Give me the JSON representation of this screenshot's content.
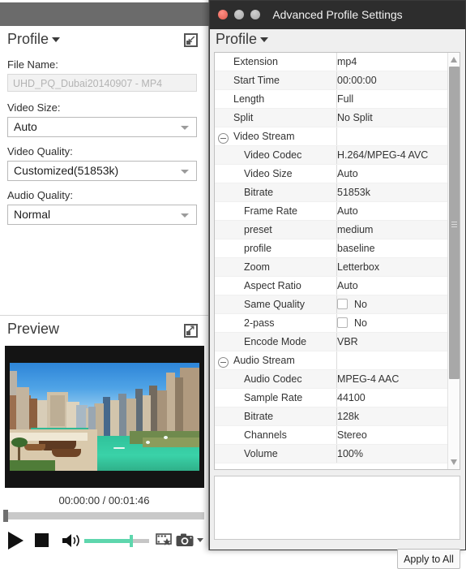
{
  "left_window": {
    "profile_section": {
      "title": "Profile",
      "collapse_icon": "collapse-arrow-icon",
      "file_name_label": "File Name:",
      "file_name_value": "UHD_PQ_Dubai20140907 - MP4",
      "video_size_label": "Video Size:",
      "video_size_value": "Auto",
      "video_quality_label": "Video Quality:",
      "video_quality_value": "Customized(51853k)",
      "audio_quality_label": "Audio Quality:",
      "audio_quality_value": "Normal"
    },
    "preview_section": {
      "title": "Preview",
      "expand_icon": "expand-arrow-icon",
      "time_display": "00:00:00 / 00:01:46",
      "current_time": "00:00:00",
      "total_time": "00:01:46",
      "seek_position_percent": 0,
      "controls": {
        "play": "play-icon",
        "stop": "stop-icon",
        "volume": "volume-icon",
        "volume_percent": 68,
        "snapshot_series": "filmstrip-star-icon",
        "snapshot": "camera-icon",
        "snapshot_menu": "chevron-down-icon"
      }
    }
  },
  "right_window": {
    "title": "Advanced Profile Settings",
    "traffic_lights": [
      "close-button",
      "minimize-button",
      "maximize-button"
    ],
    "profile_title": "Profile",
    "rows": [
      {
        "key": "Extension",
        "value": "mp4",
        "indent": 0,
        "type": "text",
        "group": false
      },
      {
        "key": "Start Time",
        "value": "00:00:00",
        "indent": 0,
        "type": "text",
        "group": false
      },
      {
        "key": "Length",
        "value": "Full",
        "indent": 0,
        "type": "text",
        "group": false
      },
      {
        "key": "Split",
        "value": "No Split",
        "indent": 0,
        "type": "text",
        "group": false
      },
      {
        "key": "Video Stream",
        "value": "",
        "indent": 0,
        "type": "text",
        "group": true
      },
      {
        "key": "Video Codec",
        "value": "H.264/MPEG-4 AVC",
        "indent": 1,
        "type": "text",
        "group": false
      },
      {
        "key": "Video Size",
        "value": "Auto",
        "indent": 1,
        "type": "text",
        "group": false
      },
      {
        "key": "Bitrate",
        "value": "51853k",
        "indent": 1,
        "type": "text",
        "group": false
      },
      {
        "key": "Frame Rate",
        "value": "Auto",
        "indent": 1,
        "type": "text",
        "group": false
      },
      {
        "key": "preset",
        "value": "medium",
        "indent": 1,
        "type": "text",
        "group": false
      },
      {
        "key": "profile",
        "value": "baseline",
        "indent": 1,
        "type": "text",
        "group": false
      },
      {
        "key": "Zoom",
        "value": "Letterbox",
        "indent": 1,
        "type": "text",
        "group": false
      },
      {
        "key": "Aspect Ratio",
        "value": "Auto",
        "indent": 1,
        "type": "text",
        "group": false
      },
      {
        "key": "Same Quality",
        "value": "No",
        "indent": 1,
        "type": "check",
        "checked": false,
        "group": false
      },
      {
        "key": "2-pass",
        "value": "No",
        "indent": 1,
        "type": "check",
        "checked": false,
        "group": false
      },
      {
        "key": "Encode Mode",
        "value": "VBR",
        "indent": 1,
        "type": "text",
        "group": false
      },
      {
        "key": "Audio Stream",
        "value": "",
        "indent": 0,
        "type": "text",
        "group": true
      },
      {
        "key": "Audio Codec",
        "value": "MPEG-4 AAC",
        "indent": 1,
        "type": "text",
        "group": false
      },
      {
        "key": "Sample Rate",
        "value": "44100",
        "indent": 1,
        "type": "text",
        "group": false
      },
      {
        "key": "Bitrate",
        "value": "128k",
        "indent": 1,
        "type": "text",
        "group": false
      },
      {
        "key": "Channels",
        "value": "Stereo",
        "indent": 1,
        "type": "text",
        "group": false
      },
      {
        "key": "Volume",
        "value": "100%",
        "indent": 1,
        "type": "text",
        "group": false
      }
    ],
    "description_text": "",
    "apply_button": "Apply to All"
  },
  "colors": {
    "accent_green": "#5ed6ad",
    "titlebar_dark": "#2d2d2d",
    "titlebar_gray": "#6b6b6b",
    "close_red": "#e05a4c",
    "panel_bg": "#efefef"
  }
}
